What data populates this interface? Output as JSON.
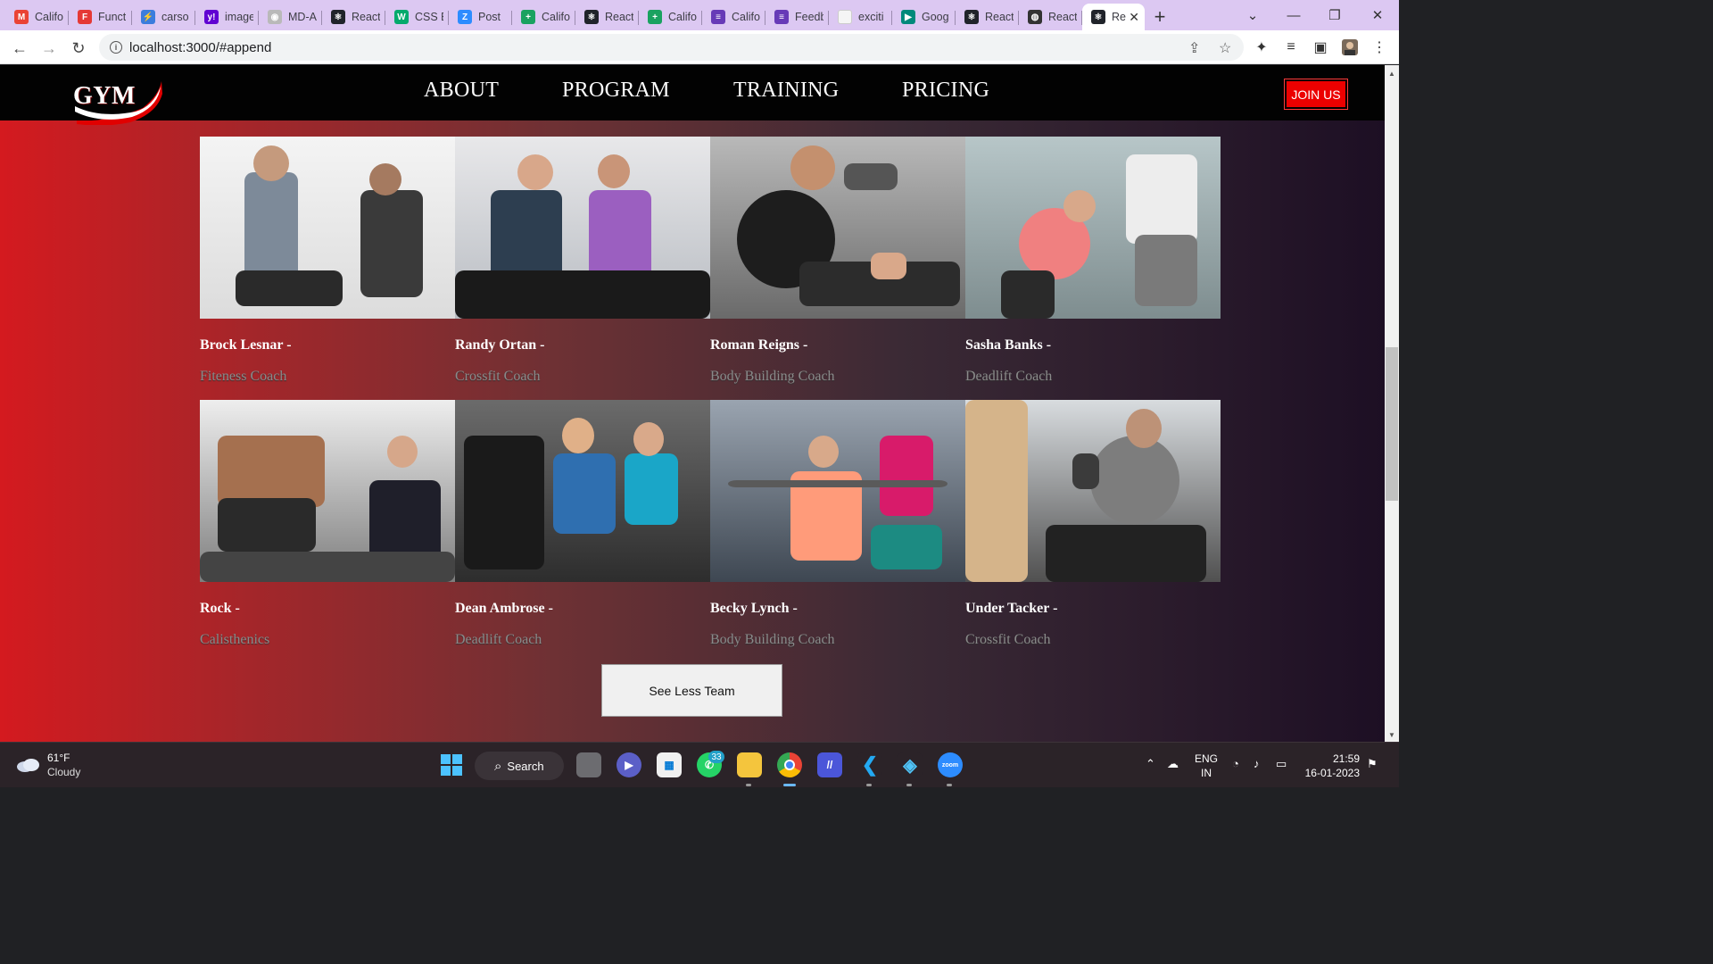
{
  "browser": {
    "tabs": [
      {
        "title": "Califo",
        "icon": "gmail-icon",
        "color": "#ea4335"
      },
      {
        "title": "Funct",
        "icon": "shield-icon",
        "color": "#e53935"
      },
      {
        "title": "carso",
        "icon": "bolt-icon",
        "color": "#3b7ddd"
      },
      {
        "title": "image",
        "icon": "yahoo-icon",
        "color": "#6001d2"
      },
      {
        "title": "MD-A",
        "icon": "github-icon",
        "color": "#b9b9b9"
      },
      {
        "title": "React",
        "icon": "react-icon",
        "color": "#20232a"
      },
      {
        "title": "CSS E",
        "icon": "w3-icon",
        "color": "#04aa6d"
      },
      {
        "title": "Post",
        "icon": "zoom-z-icon",
        "color": "#2d8cff"
      },
      {
        "title": "Califo",
        "icon": "sheets-plus-icon",
        "color": "#1aa260"
      },
      {
        "title": "React",
        "icon": "react-icon",
        "color": "#20232a"
      },
      {
        "title": "Califo",
        "icon": "sheets-plus-icon",
        "color": "#1aa260"
      },
      {
        "title": "Califo",
        "icon": "forms-icon",
        "color": "#673ab7"
      },
      {
        "title": "Feedb",
        "icon": "forms-icon",
        "color": "#673ab7"
      },
      {
        "title": "exciti",
        "icon": "blank-page-icon",
        "color": "#f5f5f5"
      },
      {
        "title": "Goog",
        "icon": "meet-icon",
        "color": "#00897b"
      },
      {
        "title": "React",
        "icon": "react-icon",
        "color": "#20232a"
      },
      {
        "title": "React",
        "icon": "globe-icon",
        "color": "#333333"
      },
      {
        "title": "Re",
        "icon": "react-icon",
        "color": "#20232a",
        "active": true
      }
    ],
    "new_tab": "+",
    "url": "localhost:3000/#append"
  },
  "page": {
    "logo": "GYM",
    "brand_color": "#e10000",
    "menu": [
      "ABOUT",
      "PROGRAM",
      "TRAINING",
      "PRICING"
    ],
    "join_label": "JOIN US",
    "team": [
      {
        "name": "Brock Lesnar -",
        "role": "Fiteness Coach",
        "photo": "man-coaching-woman-plank-photo"
      },
      {
        "name": "Randy Ortan -",
        "role": "Crossfit Coach",
        "photo": "couple-on-exercise-bikes-photo"
      },
      {
        "name": "Roman Reigns -",
        "role": "Body Building Coach",
        "photo": "trainer-spotting-bench-press-photo"
      },
      {
        "name": "Sasha Banks -",
        "role": "Deadlift Coach",
        "photo": "trainer-with-clipboard-photo"
      },
      {
        "name": "Rock -",
        "role": "Calisthenics",
        "photo": "dumbbell-row-and-lunge-photo"
      },
      {
        "name": "Dean Ambrose -",
        "role": "Deadlift Coach",
        "photo": "couple-with-tablet-photo"
      },
      {
        "name": "Becky Lynch -",
        "role": "Body Building Coach",
        "photo": "trainer-helping-barbell-photo"
      },
      {
        "name": "Under Tacker -",
        "role": "Crossfit Coach",
        "photo": "man-dumbbell-curl-photo"
      }
    ],
    "see_less_label": "See Less Team"
  },
  "taskbar": {
    "weather_temp": "61°F",
    "weather_desc": "Cloudy",
    "search_label": "Search",
    "whatsapp_badge": "33",
    "lang_line1": "ENG",
    "lang_line2": "IN",
    "time": "21:59",
    "date": "16-01-2023"
  }
}
